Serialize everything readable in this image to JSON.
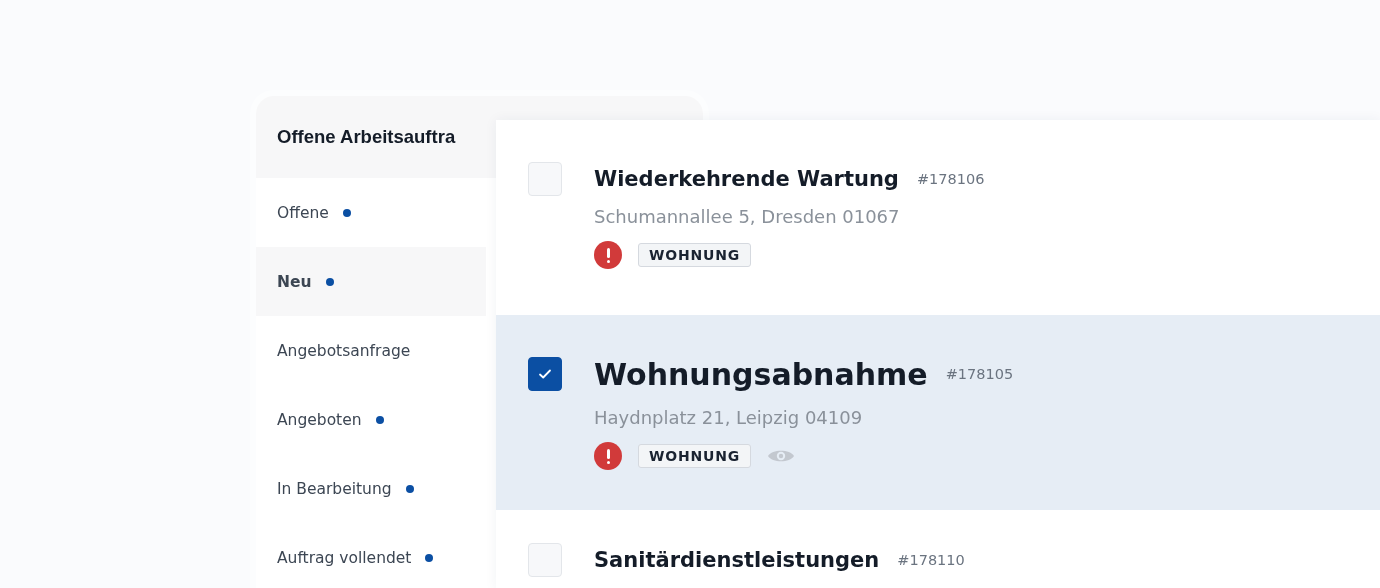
{
  "panel": {
    "title": "Offene Arbeitsauftra"
  },
  "sidebar": {
    "items": [
      {
        "label": "Offene",
        "selected": false,
        "dot": true
      },
      {
        "label": "Neu",
        "selected": true,
        "dot": true
      },
      {
        "label": "Angebotsanfrage",
        "selected": false,
        "dot": false
      },
      {
        "label": "Angeboten",
        "selected": false,
        "dot": true
      },
      {
        "label": "In Bearbeitung",
        "selected": false,
        "dot": true
      },
      {
        "label": "Auftrag vollendet",
        "selected": false,
        "dot": true
      }
    ]
  },
  "orders": [
    {
      "title": "Wiederkehrende Wartung",
      "number": "#178106",
      "address": "Schumannallee 5, Dresden 01067",
      "urgent": true,
      "tag": "WOHNUNG",
      "watched": false,
      "checked": false,
      "selected": false
    },
    {
      "title": "Wohnungsabnahme",
      "number": "#178105",
      "address": "Haydnplatz 21, Leipzig 04109",
      "urgent": true,
      "tag": "WOHNUNG",
      "watched": true,
      "checked": true,
      "selected": true
    },
    {
      "title": "Sanitärdienstleistungen",
      "number": "#178110",
      "checked": false,
      "selected": false
    }
  ]
}
